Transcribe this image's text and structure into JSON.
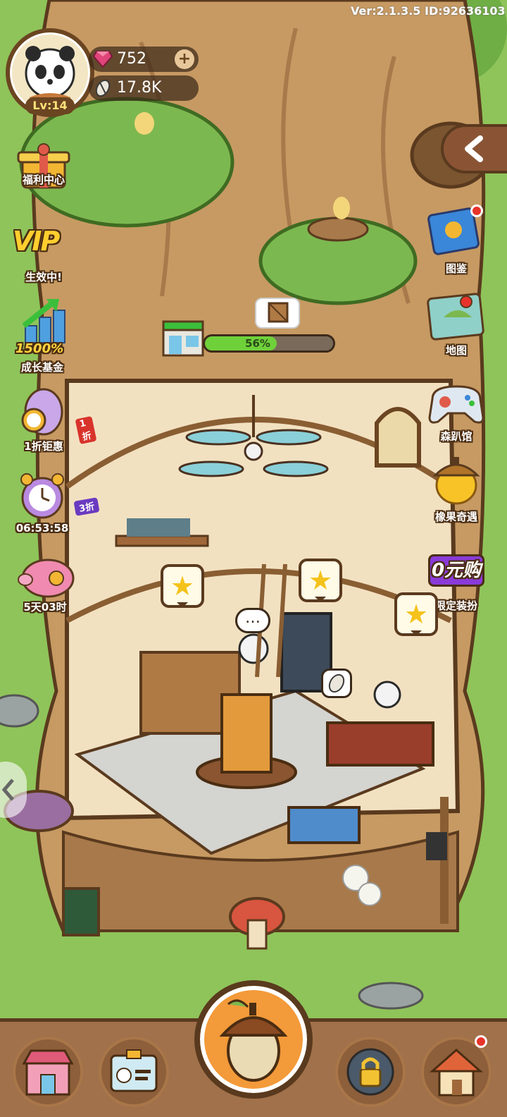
{
  "game": {
    "version_text": "Ver:2.1.3.5 ID:92636103"
  },
  "player": {
    "level_label": "Lv:14",
    "gems": "752",
    "seeds": "17.8K"
  },
  "left_menu": {
    "welfare": "福利中心",
    "vip": "生效中!",
    "vip_badge": "VIP",
    "growth_fund": "成长基金",
    "growth_fund_badge": "1500%",
    "discount": "1折钜惠",
    "discount_tag": "1折",
    "timer": "06:53:58",
    "timer_tag": "3折",
    "piggy": "5天03时"
  },
  "right_menu": {
    "atlas": "图鉴",
    "map": "地图",
    "arcade": "森趴馆",
    "acorn_adventure": "橡果奇遇",
    "zero_buy_badge": "0元购",
    "limited_outfit": "限定装扮"
  },
  "shop": {
    "progress_percent": 56,
    "progress_label": "56%"
  },
  "colors": {
    "gem": "#e0457a",
    "progress_fill": "#6fd13a",
    "trunk": "#c79a63",
    "grass": "#8fc45a",
    "panel_bg": "#a0714a"
  }
}
